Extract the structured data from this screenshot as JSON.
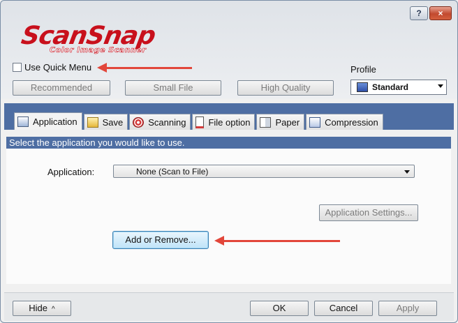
{
  "titlebar": {
    "help_label": "?",
    "close_label": "×"
  },
  "logo": {
    "main": "ScanSnap",
    "sub": "Color Image Scanner"
  },
  "quick_menu": {
    "label": "Use Quick Menu",
    "checked": false
  },
  "profile": {
    "label": "Profile",
    "selected": "Standard"
  },
  "presets": {
    "recommended": "Recommended",
    "small_file": "Small File",
    "high_quality": "High Quality"
  },
  "tabs": [
    {
      "label": "Application",
      "icon": "application-icon",
      "active": true
    },
    {
      "label": "Save",
      "icon": "folder-icon",
      "active": false
    },
    {
      "label": "Scanning",
      "icon": "scanning-icon",
      "active": false
    },
    {
      "label": "File option",
      "icon": "file-option-icon",
      "active": false
    },
    {
      "label": "Paper",
      "icon": "paper-icon",
      "active": false
    },
    {
      "label": "Compression",
      "icon": "compression-icon",
      "active": false
    }
  ],
  "panel": {
    "instruction": "Select the application you would like to use.",
    "application_label": "Application:",
    "application_value": "None (Scan to File)",
    "app_settings_label": "Application Settings...",
    "add_remove_label": "Add or Remove..."
  },
  "footer": {
    "hide_label": "Hide",
    "hide_chevron": "^",
    "ok_label": "OK",
    "cancel_label": "Cancel",
    "apply_label": "Apply"
  },
  "colors": {
    "accent_band": "#4e6ea3",
    "annotation_arrow": "#e2463a",
    "logo_red": "#c8101c"
  }
}
